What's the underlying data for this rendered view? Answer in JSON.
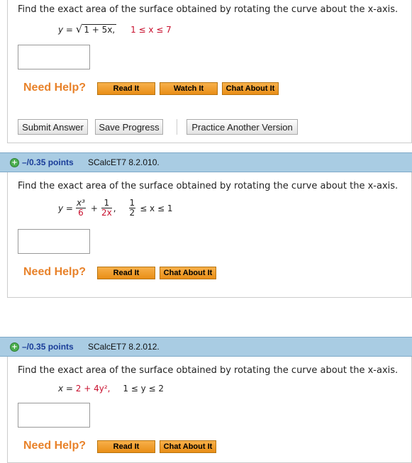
{
  "q1": {
    "prompt": "Find the exact area of the surface obtained by rotating the curve about the x-axis.",
    "eq_lhs": "y = ",
    "eq_sqrt_body": "1 + 5x,",
    "eq_range": "1 ≤ x ≤ 7",
    "need_help": "Need Help?",
    "read_it": "Read It",
    "watch_it": "Watch It",
    "chat_about_it": "Chat About It",
    "submit_answer": "Submit Answer",
    "save_progress": "Save Progress",
    "practice_another": "Practice Another Version"
  },
  "q2": {
    "points": "–/0.35 points",
    "id": "SCalcET7 8.2.010.",
    "prompt": "Find the exact area of the surface obtained by rotating the curve about the x-axis.",
    "eq_lhs": "y = ",
    "frac1_num": "x³",
    "frac1_den": "6",
    "plus": "+",
    "frac2_num": "1",
    "frac2_den": "2x",
    "comma": ",",
    "range_frac_num": "1",
    "range_frac_den": "2",
    "range_rest": "≤ x ≤ 1",
    "need_help": "Need Help?",
    "read_it": "Read It",
    "chat_about_it": "Chat About It"
  },
  "q3": {
    "points": "–/0.35 points",
    "id": "SCalcET7 8.2.012.",
    "prompt": "Find the exact area of the surface obtained by rotating the curve about the x-axis.",
    "eq_lhs": "x = ",
    "eq_rhs": "2 + 4y²,",
    "eq_range": "1 ≤ y ≤ 2",
    "need_help": "Need Help?",
    "read_it": "Read It",
    "chat_about_it": "Chat About It"
  },
  "colors": {
    "accent_orange": "#e8822a",
    "header_blue": "#a9cce3",
    "points_blue": "#1a3d99",
    "math_red": "#c8102e"
  }
}
